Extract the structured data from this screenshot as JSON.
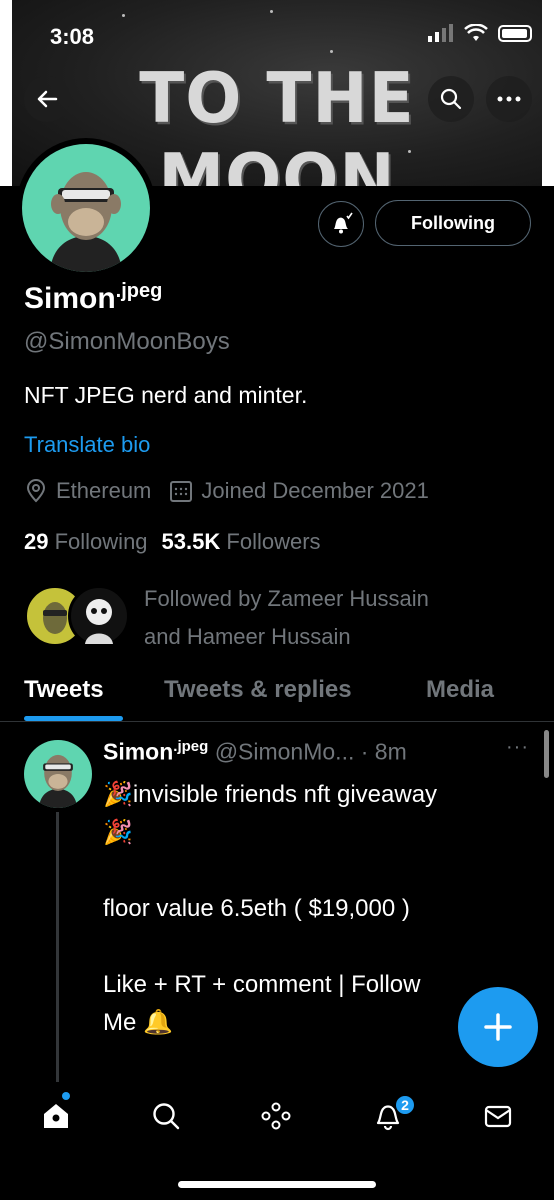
{
  "status_bar": {
    "time": "3:08"
  },
  "banner": {
    "title": "TO THE MOON"
  },
  "profile": {
    "name": "Simon",
    "name_suffix": ".jpeg",
    "handle": "@SimonMoonBoys",
    "bio": "NFT JPEG nerd and minter.",
    "translate_label": "Translate bio",
    "location": "Ethereum",
    "joined": "Joined December 2021",
    "following_count": "29",
    "following_label": "Following",
    "followers_count": "53.5K",
    "followers_label": "Followers",
    "follow_button_label": "Following",
    "followed_by_line1": "Followed by Zameer Hussain",
    "followed_by_line2": "and Hameer Hussain"
  },
  "tabs": [
    {
      "label": "Tweets"
    },
    {
      "label": "Tweets & replies"
    },
    {
      "label": "Media"
    }
  ],
  "tweet": {
    "name": "Simon",
    "name_suffix": ".jpeg",
    "handle_time": "@SimonMo... · 8m",
    "line1": "invisible friends nft giveaway",
    "line2": "floor value 6.5eth ( $19,000 )",
    "line3": "Like + RT + comment | Follow",
    "line4": "Me"
  },
  "nav": {
    "notification_badge": "2"
  },
  "colors": {
    "accent": "#1d9bf0",
    "avatar_bg": "#5fd5b0",
    "muted": "#71767b"
  },
  "icons": [
    "back-arrow-icon",
    "search-icon",
    "more-icon",
    "bell-icon",
    "location-icon",
    "calendar-icon",
    "home-icon",
    "explore-icon",
    "spaces-icon",
    "notifications-icon",
    "messages-icon",
    "compose-icon"
  ]
}
